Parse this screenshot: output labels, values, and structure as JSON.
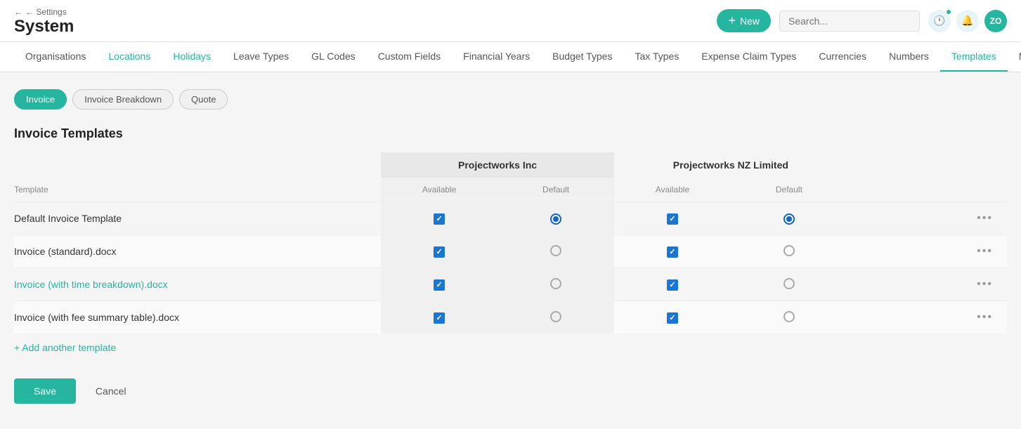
{
  "header": {
    "back_label": "← Settings",
    "page_title": "System",
    "new_button_label": "New",
    "search_placeholder": "Search...",
    "avatar_label": "ZO"
  },
  "nav": {
    "tabs": [
      {
        "id": "organisations",
        "label": "Organisations",
        "active": false
      },
      {
        "id": "locations",
        "label": "Locations",
        "active": false,
        "colored": true
      },
      {
        "id": "holidays",
        "label": "Holidays",
        "active": false,
        "colored": true
      },
      {
        "id": "leave-types",
        "label": "Leave Types",
        "active": false
      },
      {
        "id": "gl-codes",
        "label": "GL Codes",
        "active": false
      },
      {
        "id": "custom-fields",
        "label": "Custom Fields",
        "active": false
      },
      {
        "id": "financial-years",
        "label": "Financial Years",
        "active": false
      },
      {
        "id": "budget-types",
        "label": "Budget Types",
        "active": false
      },
      {
        "id": "tax-types",
        "label": "Tax Types",
        "active": false
      },
      {
        "id": "expense-claim-types",
        "label": "Expense Claim Types",
        "active": false
      },
      {
        "id": "currencies",
        "label": "Currencies",
        "active": false
      },
      {
        "id": "numbers",
        "label": "Numbers",
        "active": false
      },
      {
        "id": "templates",
        "label": "Templates",
        "active": true
      },
      {
        "id": "more",
        "label": "More...",
        "active": false
      }
    ]
  },
  "sub_tabs": [
    {
      "id": "invoice",
      "label": "Invoice",
      "active": true
    },
    {
      "id": "invoice-breakdown",
      "label": "Invoice Breakdown",
      "active": false
    },
    {
      "id": "quote",
      "label": "Quote",
      "active": false
    }
  ],
  "section_title": "Invoice Templates",
  "columns": {
    "template": "Template",
    "available": "Available",
    "default": "Default"
  },
  "orgs": [
    {
      "id": "projectworks-inc",
      "name": "Projectworks Inc"
    },
    {
      "id": "projectworks-nz",
      "name": "Projectworks NZ Limited"
    }
  ],
  "templates": [
    {
      "id": "default-invoice",
      "name": "Default Invoice Template",
      "colored": false,
      "org1_available": true,
      "org1_default": true,
      "org2_available": true,
      "org2_default": true
    },
    {
      "id": "invoice-standard",
      "name": "Invoice (standard).docx",
      "colored": false,
      "org1_available": true,
      "org1_default": false,
      "org2_available": true,
      "org2_default": false
    },
    {
      "id": "invoice-time-breakdown",
      "name": "Invoice (with time breakdown).docx",
      "colored": true,
      "org1_available": true,
      "org1_default": false,
      "org2_available": true,
      "org2_default": false
    },
    {
      "id": "invoice-fee-summary",
      "name": "Invoice (with fee summary table).docx",
      "colored": false,
      "org1_available": true,
      "org1_default": false,
      "org2_available": true,
      "org2_default": false
    }
  ],
  "add_template_label": "+ Add another template",
  "save_label": "Save",
  "cancel_label": "Cancel"
}
